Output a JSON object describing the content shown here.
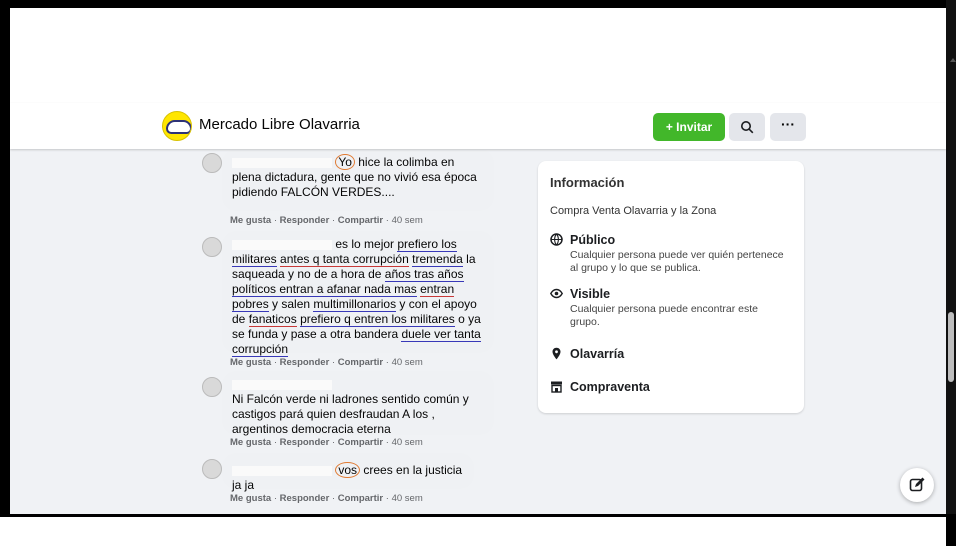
{
  "group": {
    "name": "Mercado Libre Olavarria"
  },
  "toolbar": {
    "invite_label": "+ Invitar",
    "more_label": "···"
  },
  "comments": [
    {
      "parts": [
        {
          "t": "Yo",
          "circle": true
        },
        {
          "t": " hice la colimba en plena dictadura, gente que no vivió esa época pidiendo FALCÓN VERDES...."
        }
      ],
      "like": "Me gusta",
      "reply": "Responder",
      "share": "Compartir",
      "time": "40 sem"
    },
    {
      "parts": [
        {
          "t": "es lo mejor "
        },
        {
          "t": "prefiero los militares",
          "u": "b"
        },
        {
          "t": " "
        },
        {
          "t": "antes q tanta corrupción",
          "u": "r"
        },
        {
          "t": " "
        },
        {
          "t": "tremenda",
          "u": "b"
        },
        {
          "t": " la saqueada y no de a hora de "
        },
        {
          "t": "años tras años políticos entran a afanar nada mas",
          "u": "b"
        },
        {
          "t": " "
        },
        {
          "t": "entran",
          "u": "r"
        },
        {
          "t": " "
        },
        {
          "t": "pobres",
          "u": "b"
        },
        {
          "t": " y salen "
        },
        {
          "t": "multimillonarios",
          "u": "b"
        },
        {
          "t": " y con el apoyo de "
        },
        {
          "t": "fanaticos",
          "u": "r"
        },
        {
          "t": " "
        },
        {
          "t": "prefiero q entren los militares",
          "u": "b"
        },
        {
          "t": " o ya se funda y pase a otra bandera "
        },
        {
          "t": "duele ver tanta corrupción",
          "u": "b"
        }
      ],
      "like": "Me gusta",
      "reply": "Responder",
      "share": "Compartir",
      "time": "40 sem"
    },
    {
      "parts": [
        {
          "t": "Ni Falcón verde ni ladrones sentido común y castigos pará quien desfraudan A los , argentinos "
        },
        {
          "t": "democracia eterna"
        }
      ],
      "like": "Me gusta",
      "reply": "Responder",
      "share": "Compartir",
      "time": "40 sem"
    },
    {
      "parts": [
        {
          "t": "vos",
          "circle": true
        },
        {
          "t": " crees en la justicia ja ja"
        }
      ],
      "like": "Me gusta",
      "reply": "Responder",
      "share": "Compartir",
      "time": "40 sem"
    }
  ],
  "info": {
    "title": "Información",
    "description": "Compra Venta Olavarria y la Zona",
    "rows": [
      {
        "icon": "globe-icon",
        "title": "Público",
        "sub": "Cualquier persona puede ver quién pertenece al grupo y lo que se publica."
      },
      {
        "icon": "eye-icon",
        "title": "Visible",
        "sub": "Cualquier persona puede encontrar este grupo."
      },
      {
        "icon": "location-pin-icon",
        "title": "Olavarría",
        "sub": ""
      },
      {
        "icon": "store-icon",
        "title": "Compraventa",
        "sub": ""
      }
    ]
  },
  "colors": {
    "accent_green": "#42b72a",
    "underline_blue": "#3838b8",
    "underline_red": "#c83838",
    "circle_orange": "#e07a32"
  }
}
